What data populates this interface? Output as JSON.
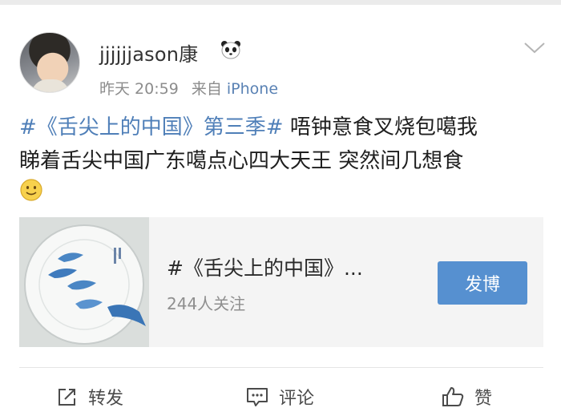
{
  "post": {
    "username": "jjjjjjason康",
    "username_badge_icon": "panda-icon",
    "time": "昨天 20:59",
    "source_prefix": "来自",
    "source": "iPhone",
    "text_tag": "#《舌尖上的中国》第三季#",
    "text_line1_rest": " 唔钟意食叉烧包噶我",
    "text_line2": "睇着舌尖中国广东噶点心四大天王 突然间几想食",
    "emoji_icon": "smile-emoji-icon",
    "menu_icon": "chevron-down-icon"
  },
  "topic": {
    "title": "#《舌尖上的中国》...",
    "followers": "244人关注",
    "button_label": "发博",
    "thumbnail_icon": "fish-plate-image"
  },
  "actions": {
    "repost": "转发",
    "comment": "评论",
    "like": "赞"
  },
  "colors": {
    "link": "#4f7fb8",
    "button": "#5690d0",
    "muted": "#8c8c8c"
  }
}
